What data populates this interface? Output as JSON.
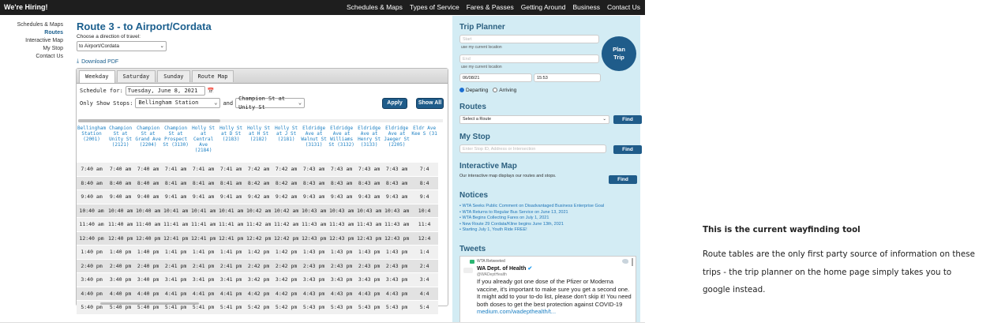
{
  "topbar": {
    "hiring": "We're Hiring!",
    "nav": [
      "Schedules & Maps",
      "Types of Service",
      "Fares & Passes",
      "Getting Around",
      "Business",
      "Contact Us"
    ]
  },
  "leftnav": {
    "items": [
      "Schedules & Maps",
      "Routes",
      "Interactive Map",
      "My Stop",
      "Contact Us"
    ],
    "active": "Routes"
  },
  "main": {
    "title": "Route 3 - to Airport/Cordata",
    "direction_label": "Choose a direction of travel:",
    "direction_value": "to Airport/Cordata",
    "download": "Download PDF"
  },
  "schedule": {
    "tabs": [
      "Weekday",
      "Saturday",
      "Sunday",
      "Route Map"
    ],
    "active_tab": "Weekday",
    "schedule_for_label": "Schedule for:",
    "schedule_date": "Tuesday, June 8, 2021",
    "only_show_label": "Only Show Stops:",
    "stop_from": "Bellingham Station",
    "and_label": "and",
    "stop_to": "Champion St at Unity St",
    "apply": "Apply",
    "show_all": "Show All",
    "columns": [
      "Bellingham Station (2001)",
      "Champion St at Unity St (2121)",
      "Champion St at Grand Ave (2204)",
      "Champion St at Prospect St (3130)",
      "Holly St at Central Ave (2184)",
      "Holly St at D St (2183)",
      "Holly St at H St (2182)",
      "Holly St at J St (2181)",
      "Eldridge Ave at Walnut St (3131)",
      "Eldridge Ave at Williams St (3132)",
      "Eldridge Ave at Henry St (3133)",
      "Eldridge Ave at Jaeger St (2205)",
      "Eldr Ave Kee S (31"
    ],
    "rows": [
      [
        "7:40 am",
        "7:40 am",
        "7:40 am",
        "7:41 am",
        "7:41 am",
        "7:41 am",
        "7:42 am",
        "7:42 am",
        "7:43 am",
        "7:43 am",
        "7:43 am",
        "7:43 am",
        "7:4"
      ],
      [
        "8:40 am",
        "8:40 am",
        "8:40 am",
        "8:41 am",
        "8:41 am",
        "8:41 am",
        "8:42 am",
        "8:42 am",
        "8:43 am",
        "8:43 am",
        "8:43 am",
        "8:43 am",
        "8:4"
      ],
      [
        "9:40 am",
        "9:40 am",
        "9:40 am",
        "9:41 am",
        "9:41 am",
        "9:41 am",
        "9:42 am",
        "9:42 am",
        "9:43 am",
        "9:43 am",
        "9:43 am",
        "9:43 am",
        "9:4"
      ],
      [
        "10:40 am",
        "10:40 am",
        "10:40 am",
        "10:41 am",
        "10:41 am",
        "10:41 am",
        "10:42 am",
        "10:42 am",
        "10:43 am",
        "10:43 am",
        "10:43 am",
        "10:43 am",
        "10:4"
      ],
      [
        "11:40 am",
        "11:40 am",
        "11:40 am",
        "11:41 am",
        "11:41 am",
        "11:41 am",
        "11:42 am",
        "11:42 am",
        "11:43 am",
        "11:43 am",
        "11:43 am",
        "11:43 am",
        "11:4"
      ],
      [
        "12:40 pm",
        "12:40 pm",
        "12:40 pm",
        "12:41 pm",
        "12:41 pm",
        "12:41 pm",
        "12:42 pm",
        "12:42 pm",
        "12:43 pm",
        "12:43 pm",
        "12:43 pm",
        "12:43 pm",
        "12:4"
      ],
      [
        "1:40 pm",
        "1:40 pm",
        "1:40 pm",
        "1:41 pm",
        "1:41 pm",
        "1:41 pm",
        "1:42 pm",
        "1:42 pm",
        "1:43 pm",
        "1:43 pm",
        "1:43 pm",
        "1:43 pm",
        "1:4"
      ],
      [
        "2:40 pm",
        "2:40 pm",
        "2:40 pm",
        "2:41 pm",
        "2:41 pm",
        "2:41 pm",
        "2:42 pm",
        "2:42 pm",
        "2:43 pm",
        "2:43 pm",
        "2:43 pm",
        "2:43 pm",
        "2:4"
      ],
      [
        "3:40 pm",
        "3:40 pm",
        "3:40 pm",
        "3:41 pm",
        "3:41 pm",
        "3:41 pm",
        "3:42 pm",
        "3:42 pm",
        "3:43 pm",
        "3:43 pm",
        "3:43 pm",
        "3:43 pm",
        "3:4"
      ],
      [
        "4:40 pm",
        "4:40 pm",
        "4:40 pm",
        "4:41 pm",
        "4:41 pm",
        "4:41 pm",
        "4:42 pm",
        "4:42 pm",
        "4:43 pm",
        "4:43 pm",
        "4:43 pm",
        "4:43 pm",
        "4:4"
      ],
      [
        "5:40 pm",
        "5:40 pm",
        "5:40 pm",
        "5:41 pm",
        "5:41 pm",
        "5:41 pm",
        "5:42 pm",
        "5:42 pm",
        "5:43 pm",
        "5:43 pm",
        "5:43 pm",
        "5:43 pm",
        "5:4"
      ]
    ]
  },
  "sidebar": {
    "trip_planner": "Trip Planner",
    "start_placeholder": "Start",
    "end_placeholder": "End",
    "use_location": "use my current location",
    "date": "06/08/21",
    "time": "15:53",
    "plan_trip_line1": "Plan",
    "plan_trip_line2": "Trip",
    "departing": "Departing",
    "arriving": "Arriving",
    "routes_heading": "Routes",
    "route_select": "Select a Route",
    "find": "Find",
    "mystop_heading": "My Stop",
    "mystop_placeholder": "Enter Stop ID, Address or Intersection",
    "map_heading": "Interactive Map",
    "map_text": "Our interactive map displays our routes and stops.",
    "notices_heading": "Notices",
    "notices": [
      "WTA Seeks Public Comment on Disadvantaged Business Enterprise Goal",
      "WTA Returns to Regular Bus Service on June 13, 2021",
      "WTA Begins Collecting Fares on July 1, 2021",
      "New Route 29 Cordata/Kline begins June 13th, 2021",
      "Starting July 1, Youth Ride FREE!"
    ],
    "tweets_heading": "Tweets",
    "tweet": {
      "retweeted": "WTA Retweeted",
      "name": "WA Dept. of Health",
      "handle": "@WADeptHealth",
      "text": "If you already got one dose of the Pfizer or Moderna vaccine, it's important to make sure you get a second one. It might add to your to-do list, please don't skip it! You need both doses to get the best protection against COVID-19",
      "link": "medium.com/wadepthealth/t..."
    }
  },
  "caption": {
    "title": "This is the current wayfinding tool",
    "body": "Route tables are the only first party source of information on these trips - the trip planner on the home page simply takes you to google instead."
  }
}
